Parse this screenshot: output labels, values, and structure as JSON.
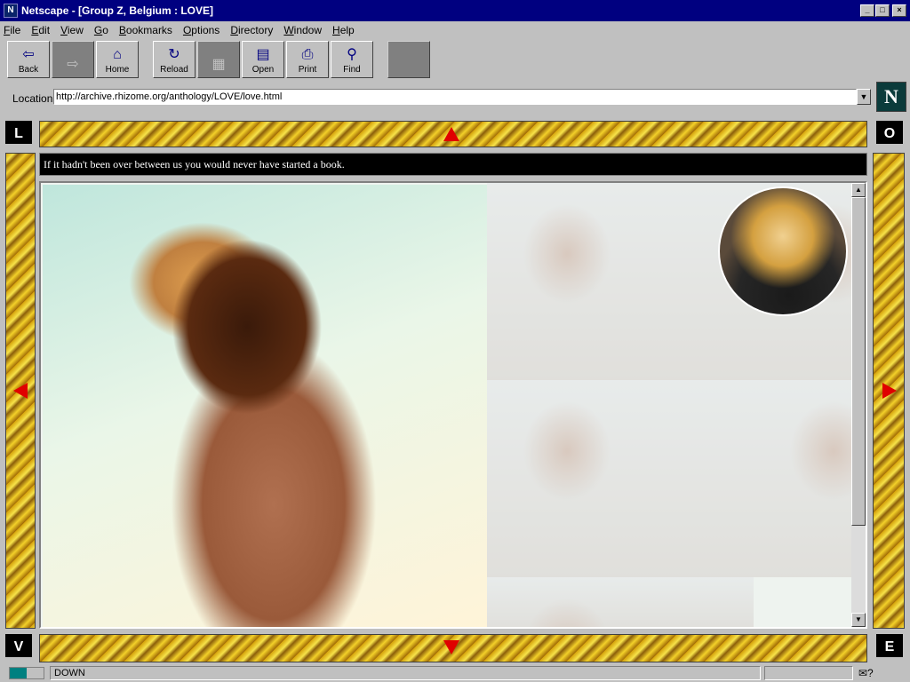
{
  "window": {
    "title": "Netscape - [Group Z, Belgium : LOVE]"
  },
  "menu": [
    "File",
    "Edit",
    "View",
    "Go",
    "Bookmarks",
    "Options",
    "Directory",
    "Window",
    "Help"
  ],
  "toolbar": {
    "back": "Back",
    "home": "Home",
    "reload": "Reload",
    "open": "Open",
    "print": "Print",
    "find": "Find"
  },
  "location": {
    "label": "Location:",
    "url": "http://archive.rhizome.org/anthology/LOVE/love.html"
  },
  "frame": {
    "corner_tl": "L",
    "corner_tr": "O",
    "corner_bl": "V",
    "corner_br": "E",
    "quote": "If it hadn't been over between us you would never have started a book."
  },
  "status": {
    "text": "DOWN"
  },
  "icons": {
    "netscape_logo": "N",
    "back": "back-arrow-icon",
    "home": "home-icon",
    "reload": "reload-icon",
    "open": "open-icon",
    "print": "printer-icon",
    "find": "binoculars-icon"
  },
  "colors": {
    "arrow": "#e00000",
    "titlebar": "#000080"
  }
}
